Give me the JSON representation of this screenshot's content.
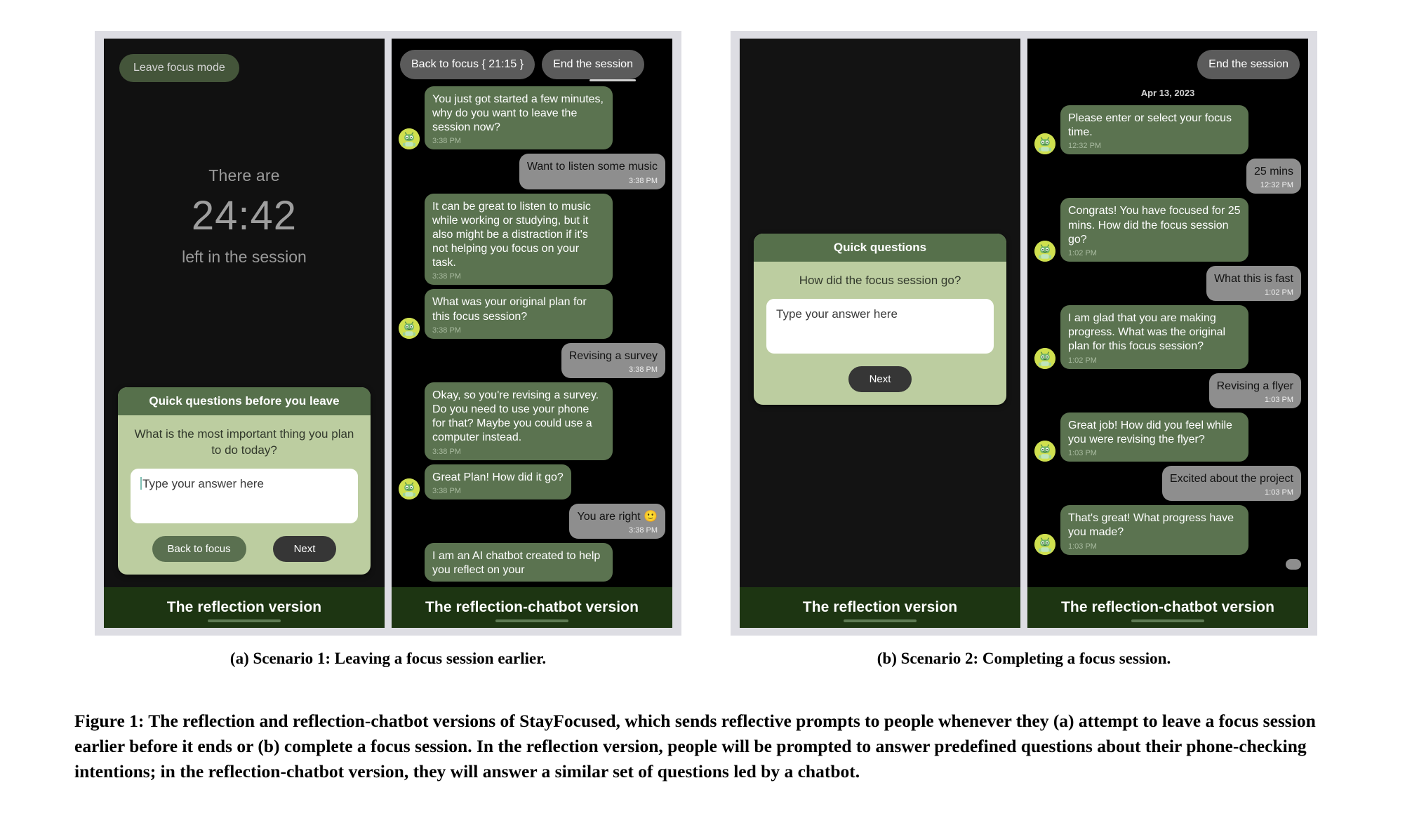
{
  "figure": {
    "caption": "Figure 1: The reflection and reflection-chatbot versions of StayFocused, which sends reflective prompts to people whenever they (a) attempt to leave a focus session earlier before it ends or (b) complete a focus session. In the reflection version, people will be prompted to answer predefined questions about their phone-checking intentions; in the reflection-chatbot version, they will answer a similar set of questions led by a chatbot."
  },
  "subfigures": [
    {
      "caption": "(a) Scenario 1: Leaving a focus session earlier."
    },
    {
      "caption": "(b) Scenario 2: Completing a focus session."
    }
  ],
  "phone_a_reflection": {
    "footer_label": "The reflection version",
    "leave_button": "Leave focus mode",
    "timer": {
      "prefix": "There are",
      "value": "24:42",
      "suffix": "left in the session"
    },
    "quick_questions": {
      "title": "Quick questions before you leave",
      "question": "What is the most important thing you plan to do today?",
      "input_placeholder": "Type your answer here",
      "input_value": "",
      "back_button": "Back to focus",
      "next_button": "Next"
    }
  },
  "phone_a_chatbot": {
    "footer_label": "The reflection-chatbot version",
    "topbar": {
      "back_to_focus": "Back to focus { 21:15 }",
      "end_session": "End the session"
    },
    "messages": [
      {
        "from": "bot",
        "text": "You just got started a few minutes, why do you want to leave the session now?",
        "time": "3:38 PM",
        "avatar": true
      },
      {
        "from": "user",
        "text": "Want to listen some music",
        "time": "3:38 PM"
      },
      {
        "from": "bot",
        "text": "It can be great to listen to music while working or studying, but it also might be a distraction if it's not helping you focus on your task.",
        "time": "3:38 PM",
        "avatar": false
      },
      {
        "from": "bot",
        "text": "What was your original plan for this focus session?",
        "time": "3:38 PM",
        "avatar": true
      },
      {
        "from": "user",
        "text": "Revising a survey",
        "time": "3:38 PM"
      },
      {
        "from": "bot",
        "text": " Okay, so you're revising a survey. Do you need to use your phone for that? Maybe you could use a computer instead.",
        "time": "3:38 PM",
        "avatar": false
      },
      {
        "from": "bot",
        "text": "Great Plan! How did it go?",
        "time": "3:38 PM",
        "avatar": true
      },
      {
        "from": "user",
        "text": "You are right 🙂",
        "time": "3:38 PM"
      },
      {
        "from": "bot",
        "text": " I am an AI chatbot created to help you reflect on your",
        "time": "",
        "avatar": false,
        "clipped": true
      }
    ]
  },
  "phone_b_reflection": {
    "footer_label": "The reflection version",
    "quick_questions": {
      "title": "Quick questions",
      "question": "How did the focus session go?",
      "input_placeholder": "Type your answer here",
      "input_value": "",
      "next_button": "Next"
    }
  },
  "phone_b_chatbot": {
    "footer_label": "The reflection-chatbot version",
    "topbar": {
      "end_session": "End the session"
    },
    "date_stamp": "Apr 13, 2023",
    "messages": [
      {
        "from": "bot",
        "text": "Please enter or select your focus time.",
        "time": "12:32 PM",
        "avatar": true
      },
      {
        "from": "user",
        "text": "25 mins",
        "time": "12:32 PM"
      },
      {
        "from": "bot",
        "text": "Congrats! You have focused for 25 mins. How did the focus session go?",
        "time": "1:02 PM",
        "avatar": true
      },
      {
        "from": "user",
        "text": "What this is fast",
        "time": "1:02 PM"
      },
      {
        "from": "bot",
        "text": " I am glad that you are making progress. What was the original plan for this focus session?",
        "time": "1:02 PM",
        "avatar": true
      },
      {
        "from": "user",
        "text": "Revising a flyer",
        "time": "1:03 PM"
      },
      {
        "from": "bot",
        "text": "Great job! How did you feel while you were revising the flyer?",
        "time": "1:03 PM",
        "avatar": true
      },
      {
        "from": "user",
        "text": "Excited about the project",
        "time": "1:03 PM"
      },
      {
        "from": "bot",
        "text": " That's great! What progress have you made?",
        "time": "1:03 PM",
        "avatar": true
      },
      {
        "from": "user",
        "text": "",
        "time": "",
        "clipped": true
      }
    ]
  },
  "colors": {
    "bot_bubble": "#5b7350",
    "user_bubble": "#8e8e8e",
    "card_body": "#bccda0",
    "card_header": "#56704b",
    "footer": "#1d3512",
    "frame": "#dddde3"
  }
}
